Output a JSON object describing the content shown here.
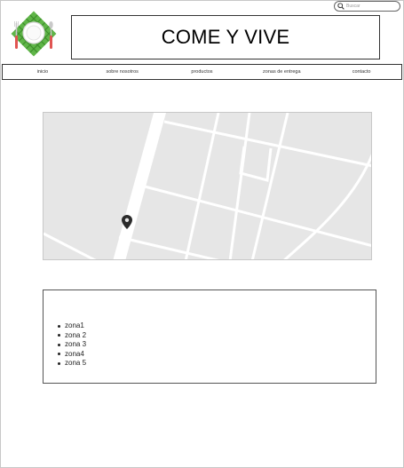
{
  "search": {
    "placeholder": "Buscar",
    "icon": "search-icon"
  },
  "header": {
    "title": "COME Y VIVE",
    "logo_icon": "plate-cutlery-icon"
  },
  "nav": {
    "items": [
      {
        "label": "inicio"
      },
      {
        "label": "sobre nosotros"
      },
      {
        "label": "productos"
      },
      {
        "label": "zonas de entrega"
      },
      {
        "label": "contacto"
      }
    ]
  },
  "map": {
    "marker_icon": "map-pin-icon"
  },
  "zones": {
    "items": [
      {
        "label": "zona1"
      },
      {
        "label": "zona 2"
      },
      {
        "label": "zona 3"
      },
      {
        "label": "zona4"
      },
      {
        "label": "zona 5"
      }
    ]
  }
}
